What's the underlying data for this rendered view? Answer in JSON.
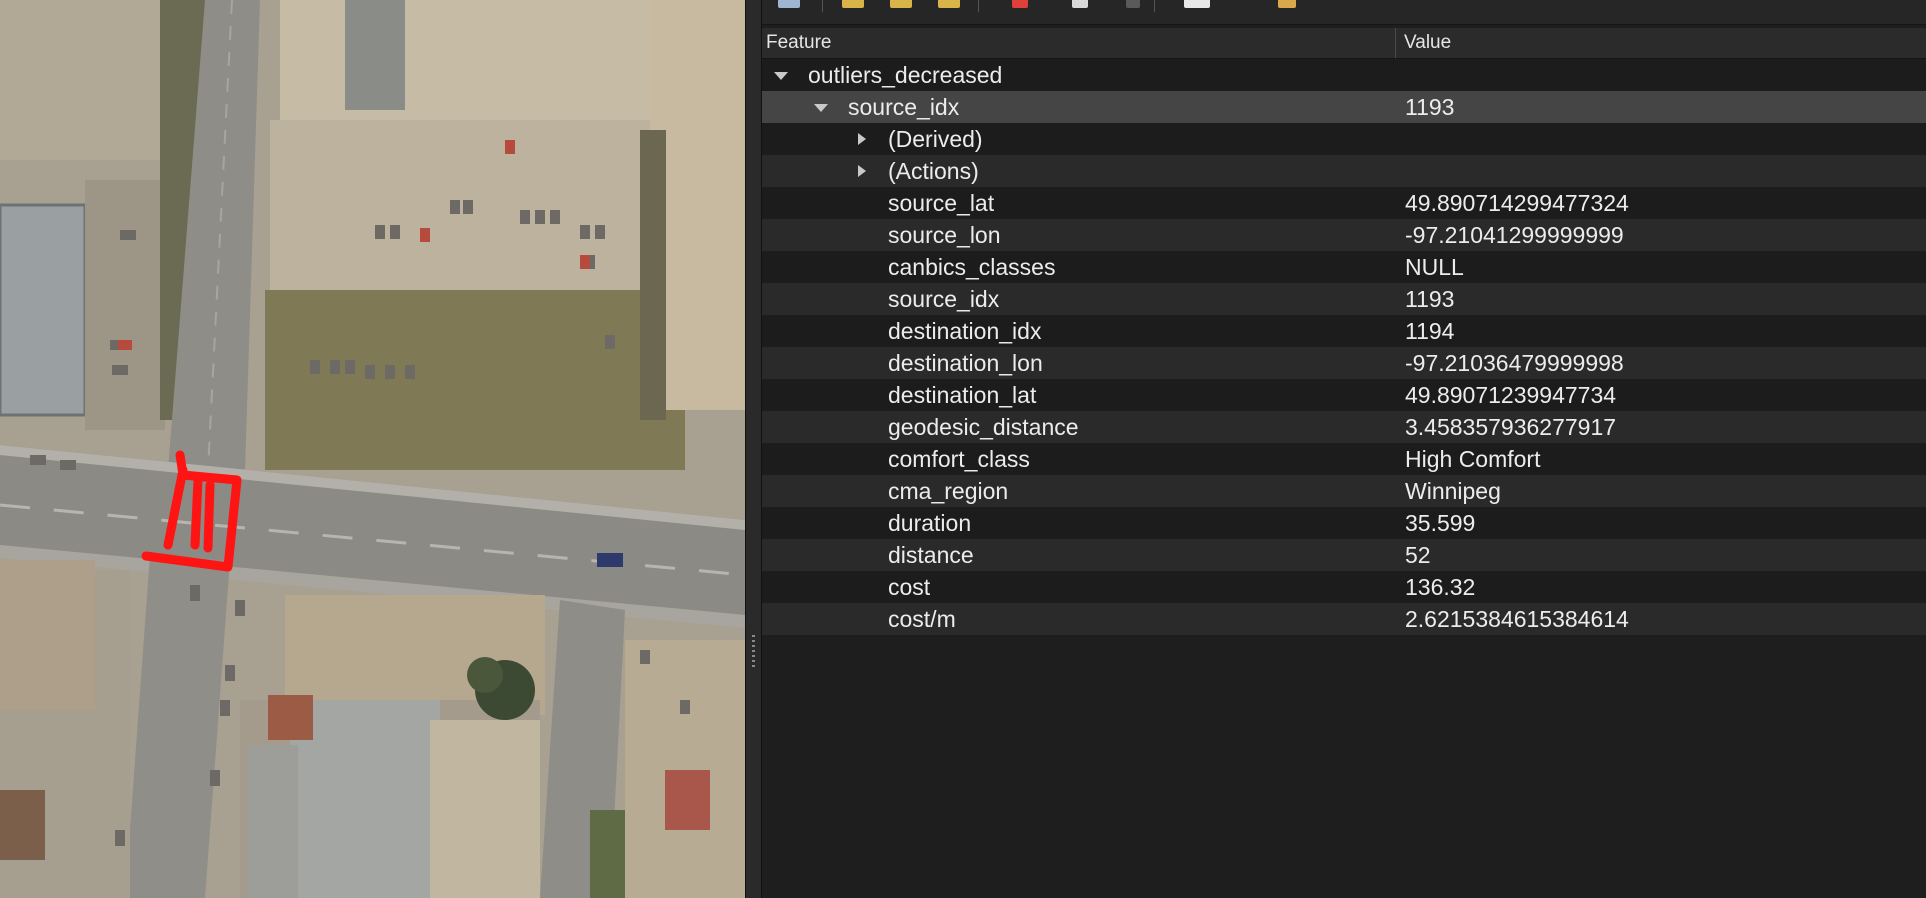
{
  "map": {
    "colors": {
      "asphalt": "#8c8c86",
      "lot": "#b7ad98",
      "roof": "#9ea3a3",
      "grass": "#7e7a56",
      "highlight": "#ff1414"
    }
  },
  "toolbar": {
    "icons": [
      "expand-new-results-icon",
      "select-features-icon",
      "select-features-icon",
      "select-features-icon",
      "clear-results-icon",
      "copy-feature-icon",
      "print-icon",
      "identify-settings-icon",
      "help-icon"
    ]
  },
  "table": {
    "header": {
      "feature": "Feature",
      "value": "Value"
    },
    "layer": {
      "name": "outliers_decreased"
    },
    "feature": {
      "name": "source_idx",
      "value": "1193"
    },
    "groups": [
      {
        "label": "(Derived)"
      },
      {
        "label": "(Actions)"
      }
    ],
    "attributes": [
      {
        "name": "source_lat",
        "value": "49.890714299477324"
      },
      {
        "name": "source_lon",
        "value": "-97.21041299999999"
      },
      {
        "name": "canbics_classes",
        "value": "NULL"
      },
      {
        "name": "source_idx",
        "value": "1193"
      },
      {
        "name": "destination_idx",
        "value": "1194"
      },
      {
        "name": "destination_lon",
        "value": "-97.21036479999998"
      },
      {
        "name": "destination_lat",
        "value": "49.89071239947734"
      },
      {
        "name": "geodesic_distance",
        "value": "3.458357936277917"
      },
      {
        "name": "comfort_class",
        "value": "High Comfort"
      },
      {
        "name": "cma_region",
        "value": "Winnipeg"
      },
      {
        "name": "duration",
        "value": "35.599"
      },
      {
        "name": "distance",
        "value": "52"
      },
      {
        "name": "cost",
        "value": "136.32"
      },
      {
        "name": "cost/m",
        "value": "2.6215384615384614"
      }
    ]
  }
}
